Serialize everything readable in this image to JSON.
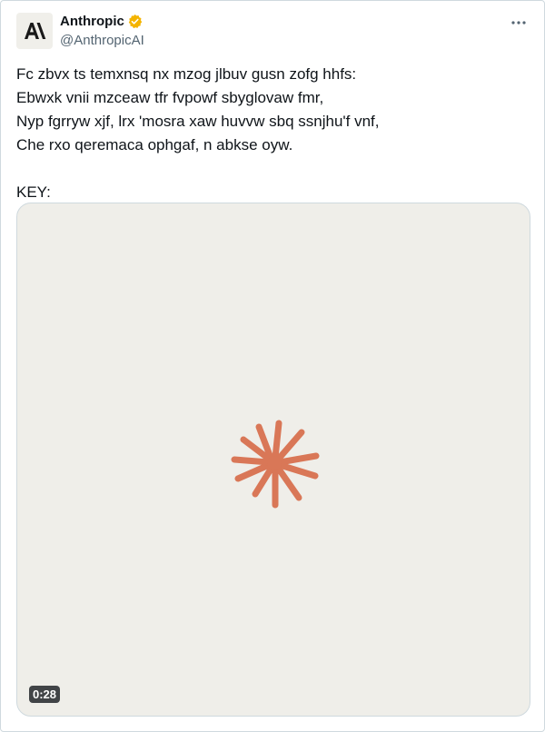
{
  "author": {
    "display_name": "Anthropic",
    "handle": "@AnthropicAI",
    "avatar_icon": "anthropic-logo",
    "verified_icon": "verified-badge-icon",
    "verified_color": "#f4b400"
  },
  "tweet": {
    "text": "Fc zbvx ts temxnsq nx mzog jlbuv gusn zofg hhfs:\nEbwxk vnii mzceaw tfr fvpowf sbyglovaw fmr,\nNyp fgrryw xjf, lrx 'mosra xaw huvvw sbq ssnjhu'f vnf,\nChe rxo qeremaca ophgaf, n abkse oyw.\n\nKEY:"
  },
  "media": {
    "background": "#efeee9",
    "graphic_icon": "asterisk-burst-icon",
    "graphic_color": "#d97757",
    "duration": "0:28"
  },
  "actions": {
    "more_icon": "more-horizontal-icon"
  }
}
